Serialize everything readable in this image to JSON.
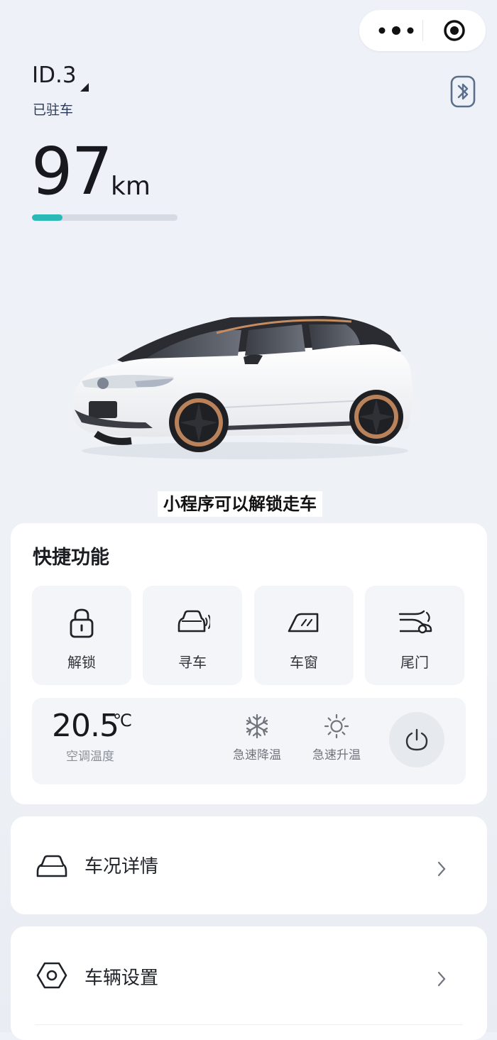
{
  "header": {
    "capsule": {
      "more_icon": "more-dots-icon",
      "close_icon": "target-circle-icon"
    },
    "car_name": "ID.3",
    "car_status": "已驻车",
    "bluetooth_icon": "bluetooth-icon"
  },
  "range": {
    "value": "97",
    "unit": "km",
    "battery_fraction": 0.21,
    "bar_color": "#2bb9b8"
  },
  "subtitle": "小程序可以解锁走车",
  "quick": {
    "title": "快捷功能",
    "tiles": [
      {
        "label": "解锁",
        "icon": "lock-icon"
      },
      {
        "label": "寻车",
        "icon": "find-car-icon"
      },
      {
        "label": "车窗",
        "icon": "car-window-icon"
      },
      {
        "label": "尾门",
        "icon": "tailgate-icon"
      }
    ],
    "ac": {
      "temperature": "20.5",
      "unit": "℃",
      "label": "空调温度",
      "buttons": [
        {
          "label": "急速降温",
          "icon": "snowflake-icon"
        },
        {
          "label": "急速升温",
          "icon": "sun-icon"
        }
      ],
      "power_icon": "power-icon"
    }
  },
  "rows": [
    {
      "label": "车况详情",
      "icon": "car-status-icon"
    },
    {
      "label": "车辆设置",
      "icon": "hex-settings-icon"
    }
  ],
  "colors": {
    "accent": "#2bb9b8",
    "card": "#ffffff",
    "tile": "#f3f5f8"
  }
}
